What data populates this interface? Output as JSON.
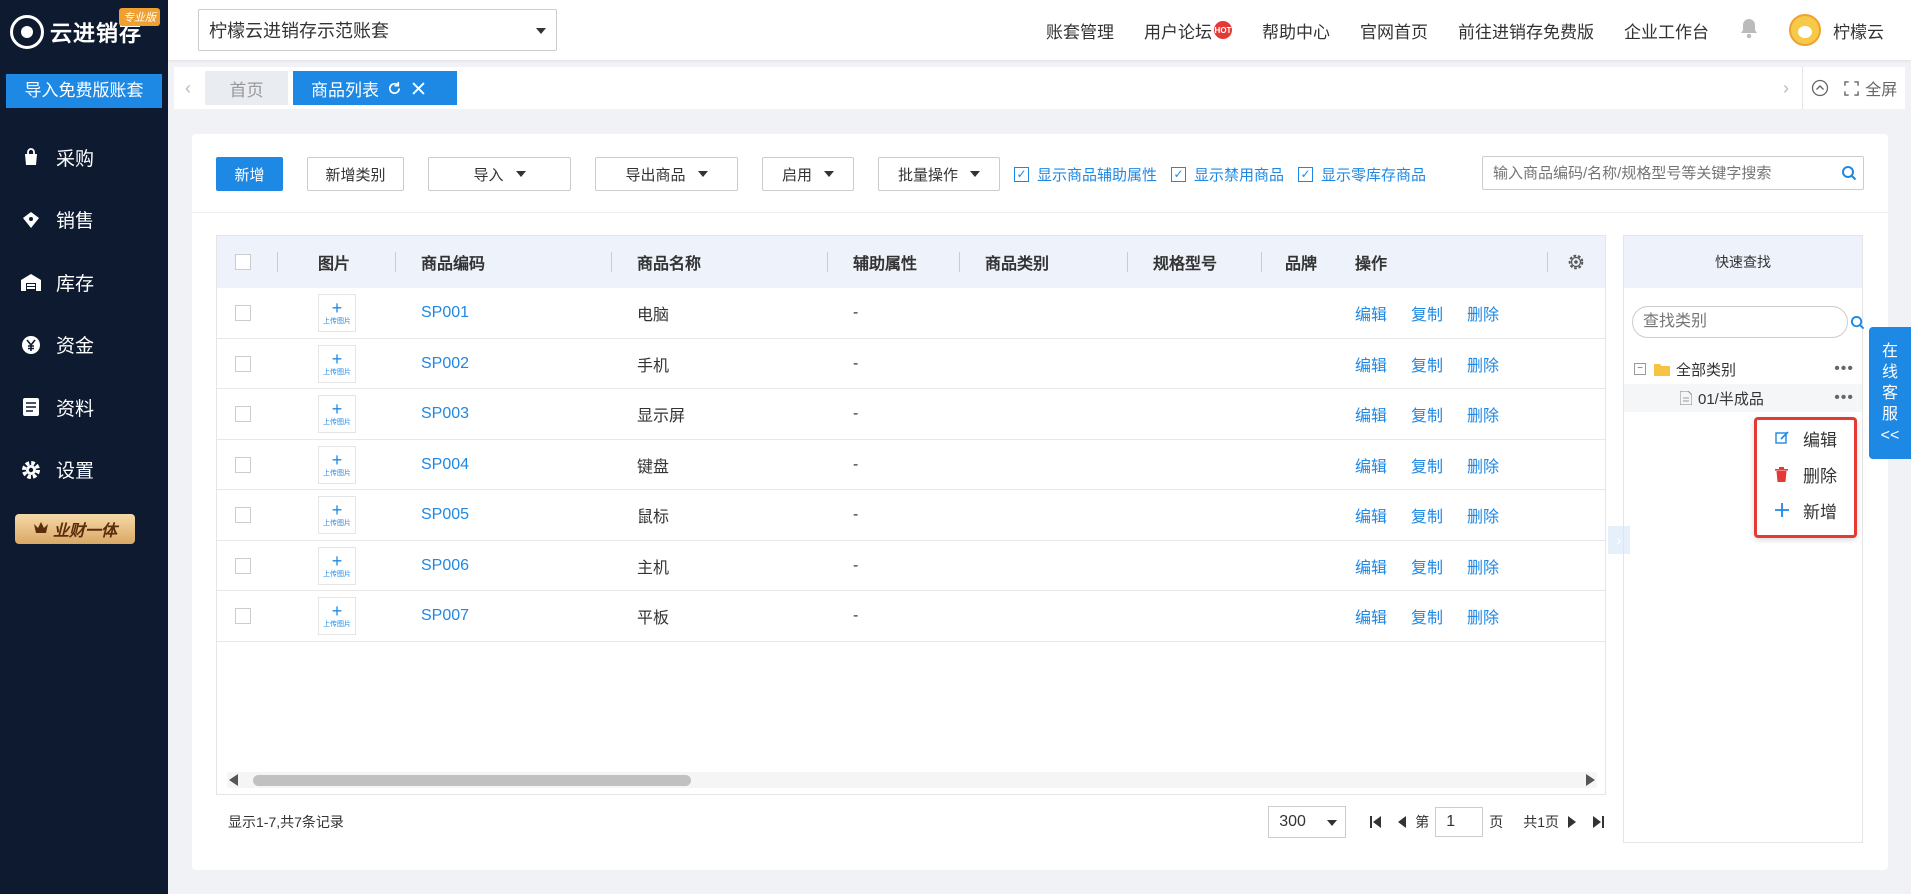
{
  "sidebar": {
    "logo_text": "云进销存",
    "logo_badge": "专业版",
    "import_button": "导入免费版账套",
    "nav": [
      {
        "label": "采购",
        "icon": "shopping-bag-icon"
      },
      {
        "label": "销售",
        "icon": "sales-tag-icon"
      },
      {
        "label": "库存",
        "icon": "warehouse-icon"
      },
      {
        "label": "资金",
        "icon": "yen-coin-icon"
      },
      {
        "label": "资料",
        "icon": "document-icon"
      },
      {
        "label": "设置",
        "icon": "gear-icon"
      }
    ],
    "vip_badge": "业财一体"
  },
  "topbar": {
    "account": "柠檬云进销存示范账套",
    "links": [
      "账套管理",
      "用户论坛",
      "帮助中心",
      "官网首页",
      "前往进销存免费版",
      "企业工作台"
    ],
    "hot_badge": "HOT",
    "user_name": "柠檬云"
  },
  "tabs": {
    "home": "首页",
    "active": "商品列表",
    "fullscreen": "全屏"
  },
  "toolbar": {
    "add": "新增",
    "add_category": "新增类别",
    "import": "导入",
    "export": "导出商品",
    "enable": "启用",
    "batch": "批量操作",
    "check_aux": "显示商品辅助属性",
    "check_disabled": "显示禁用商品",
    "check_zero": "显示零库存商品",
    "search_placeholder": "输入商品编码/名称/规格型号等关键字搜索"
  },
  "table": {
    "columns": [
      "图片",
      "商品编码",
      "商品名称",
      "辅助属性",
      "商品类别",
      "规格型号",
      "品牌",
      "操作"
    ],
    "upload_label": "上传图片",
    "ops": [
      "编辑",
      "复制",
      "删除"
    ],
    "rows": [
      {
        "code": "SP001",
        "name": "电脑",
        "aux": "-"
      },
      {
        "code": "SP002",
        "name": "手机",
        "aux": "-"
      },
      {
        "code": "SP003",
        "name": "显示屏",
        "aux": "-"
      },
      {
        "code": "SP004",
        "name": "键盘",
        "aux": "-"
      },
      {
        "code": "SP005",
        "name": "鼠标",
        "aux": "-"
      },
      {
        "code": "SP006",
        "name": "主机",
        "aux": "-"
      },
      {
        "code": "SP007",
        "name": "平板",
        "aux": "-"
      }
    ]
  },
  "footer": {
    "records": "显示1-7,共7条记录",
    "page_size": "300",
    "page_prefix": "第",
    "page_current": "1",
    "page_suffix": "页",
    "page_total": "共1页"
  },
  "panel": {
    "title": "快速查找",
    "search_placeholder": "查找类别",
    "tree": [
      {
        "label": "全部类别",
        "toggle": "−"
      },
      {
        "label": "01/半成品"
      }
    ],
    "more": "•••",
    "context_menu": [
      {
        "label": "编辑",
        "icon": "edit-icon"
      },
      {
        "label": "删除",
        "icon": "trash-icon"
      },
      {
        "label": "新增",
        "icon": "plus-icon"
      }
    ]
  },
  "service": {
    "chars": [
      "在",
      "线",
      "客",
      "服",
      "<<"
    ]
  },
  "colors": {
    "primary": "#1e88e5",
    "sidebar_bg": "#0d1a30",
    "highlight_red": "#e53935"
  }
}
